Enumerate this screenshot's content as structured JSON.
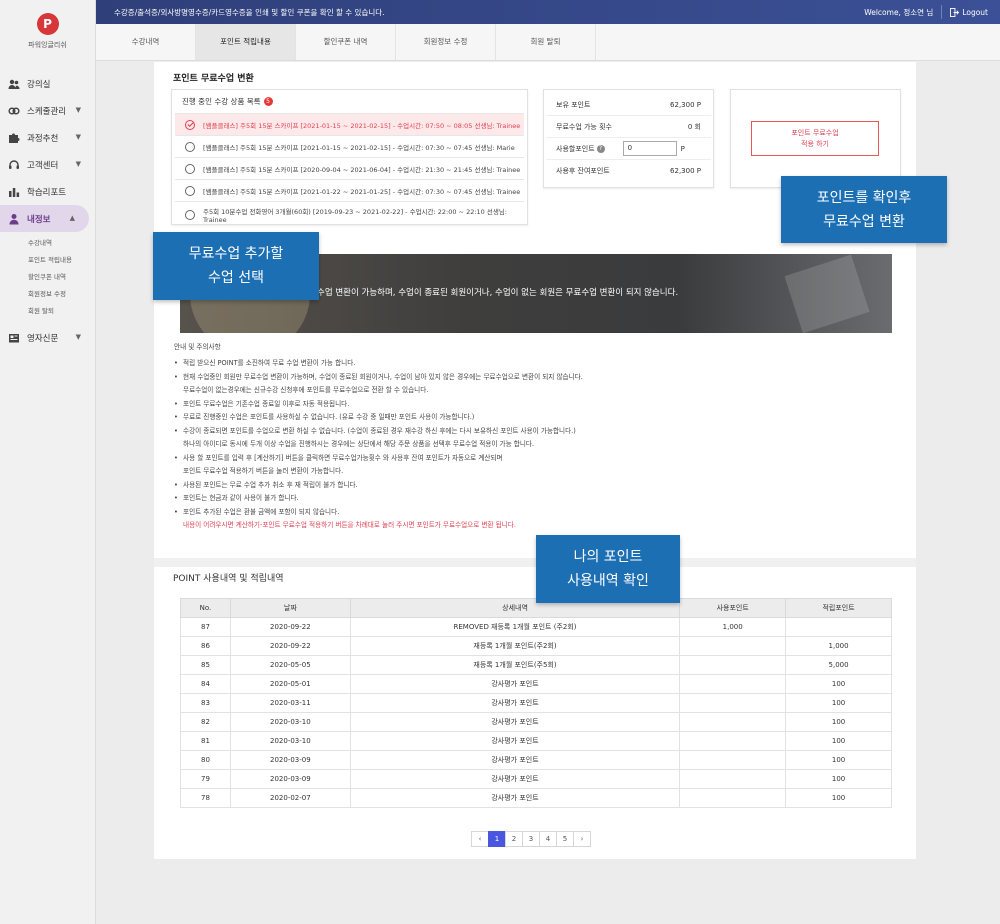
{
  "app": {
    "logo_letter": "P",
    "logo_text": "파워잉글리쉬"
  },
  "topbar": {
    "notice": "수강증/출석증/외사방명영수증/카드영수증을 인쇄 및 할인 쿠폰을 확인 할 수 있습니다.",
    "welcome": "Welcome, 정소연 님",
    "logout": "Logout"
  },
  "tabs": [
    "수강내역",
    "포인트 적립내용",
    "할인쿠폰 내역",
    "회원정보 수정",
    "회원 탈퇴"
  ],
  "sidebar": {
    "items": [
      "강의실",
      "스케줄관리",
      "과정추천",
      "고객센터",
      "학습리포트",
      "내정보",
      "영자신문"
    ],
    "submenu": [
      "수강내역",
      "포인트 적립내용",
      "할인쿠폰 내역",
      "회원정보 수정",
      "회원 탈퇴"
    ]
  },
  "convert": {
    "title": "포인트 무료수업 변환",
    "list_title": "진행 중인 수강 상품 목록",
    "badge": "5",
    "courses": [
      "[쌤플클래스] 주5회 15분 스카이프 [2021-01-15 ~ 2021-02-15] - 수업시간: 07:50 ~ 08:05 선생님: Trainee",
      "[쌤플클래스] 주5회 15분 스카이프 [2021-01-15 ~ 2021-02-15] - 수업시간: 07:30 ~ 07:45 선생님: Marie",
      "[쌤플클래스] 주5회 15분 스카이프 [2020-09-04 ~ 2021-06-04] - 수업시간: 21:30 ~ 21:45 선생님: Trainee",
      "[쌤플클래스] 주5회 15분 스카이프 [2021-01-22 ~ 2021-01-25] - 수업시간: 07:30 ~ 07:45 선생님: Trainee",
      "주5회 10분수업 전화영어 3개월(60회) [2019-09-23 ~ 2021-02-22] - 수업시간: 22:00 ~ 22:10 선생님: Trainee"
    ],
    "points": {
      "owned_label": "보유 포인트",
      "owned_value": "62,300 P",
      "count_label": "무료수업 가능 횟수",
      "count_value": "0 회",
      "use_label": "사용할포인트",
      "help": "?",
      "use_value": "0",
      "use_unit": "P",
      "remain_label": "사용후 잔여포인트",
      "remain_value": "62,300 P"
    },
    "apply_line1": "포인트 무료수업",
    "apply_line2": "적용 하기"
  },
  "banner": {
    "text": "수업 변환이 가능하며, 수업이 종료된 회원이거나, 수업이 없는 회원은 무료수업 변환이 되지 않습니다."
  },
  "notes": {
    "heading": "안내 및 주의사항",
    "lines": [
      {
        "t": "적립 받으신 POINT를 소진하여 무료 수업 변환이 가능 합니다.",
        "b": true
      },
      {
        "t": "현재 수업중인 회원만 무료수업 변환이 가능하며, 수업이 종료된 회원이거나, 수업이 남아 있지 않은 경우에는 무료수업으로 변환이 되지 않습니다.",
        "b": true
      },
      {
        "t": "무료수업이 없는경우에는 신규수강 신청후에 포인트를 무료수업으로 전환 할 수 있습니다.",
        "b": false
      },
      {
        "t": "포인트 무료수업은 기존수업 종료일 이후로 자동 적용됩니다.",
        "b": true
      },
      {
        "t": "무료로 진행중인 수업은 포인트를 사용하실 수 없습니다. (유료 수강 중 일때만 포인트 사용이 가능합니다.)",
        "b": true
      },
      {
        "t": "수강이 종료되면 포인트를 수업으로 변환 하실 수 없습니다. (수업이 종료된 경우 재수강 하신 후에는 다시 보유하신 포인트 사용이 가능합니다.)",
        "b": true
      },
      {
        "t": "하나의 아이디로 동시에 두개 이상 수업을 진행하시는 경우에는 상단에서 해당 주문 상품을 선택후 무료수업 적용이 가능 합니다.",
        "b": false
      },
      {
        "t": "사용 할 포인트를 입력 후 [계산하기] 버튼을 클릭하면 무료수업가능횟수 와 사용후 잔여 포인트가 자동으로 계산되며",
        "b": true
      },
      {
        "t": "포인트 무료수업 적용하기 버튼을 눌러 변환이 가능합니다.",
        "b": false
      },
      {
        "t": "사용된 포인트는 무료 수업 추가 취소 후 재 적립이 불가 합니다.",
        "b": true
      },
      {
        "t": "포인트는 현금과 같이 사용이 불가 합니다.",
        "b": true
      },
      {
        "t": "포인트 추가된 수업은 환불 금액에 포함이 되지 않습니다.",
        "b": true
      }
    ],
    "red": "내용이 어려우시면 계산하기-포인트 무료수업 적용하기 버튼을 차례대로 눌러 주시면 포인트가 무료수업으로 변환 됩니다."
  },
  "history": {
    "title": "POINT 사용내역 및 적립내역",
    "columns": [
      "No.",
      "날짜",
      "상세내역",
      "사용포인트",
      "적립포인트"
    ],
    "rows": [
      [
        "87",
        "2020-09-22",
        "REMOVED 재등록 1개월 포인트 (주2회)",
        "1,000",
        ""
      ],
      [
        "86",
        "2020-09-22",
        "재등록 1개월 포인트(주2회)",
        "",
        "1,000"
      ],
      [
        "85",
        "2020-05-05",
        "재등록 1개월 포인트(주5회)",
        "",
        "5,000"
      ],
      [
        "84",
        "2020-05-01",
        "강사평가 포인트",
        "",
        "100"
      ],
      [
        "83",
        "2020-03-11",
        "강사평가 포인트",
        "",
        "100"
      ],
      [
        "82",
        "2020-03-10",
        "강사평가 포인트",
        "",
        "100"
      ],
      [
        "81",
        "2020-03-10",
        "강사평가 포인트",
        "",
        "100"
      ],
      [
        "80",
        "2020-03-09",
        "강사평가 포인트",
        "",
        "100"
      ],
      [
        "79",
        "2020-03-09",
        "강사평가 포인트",
        "",
        "100"
      ],
      [
        "78",
        "2020-02-07",
        "강사평가 포인트",
        "",
        "100"
      ]
    ]
  },
  "pagination": {
    "prev": "‹",
    "pages": [
      "1",
      "2",
      "3",
      "4",
      "5"
    ],
    "next": "›"
  },
  "callouts": {
    "select_line1": "무료수업 추가할",
    "select_line2": "수업 선택",
    "confirm_line1": "포인트를 확인후",
    "confirm_line2": "무료수업 변환",
    "history_line1": "나의 포인트",
    "history_line2": "사용내역 확인"
  },
  "colors": {
    "accent": "#1d6fb4",
    "topbar": "#33447f",
    "selected": "#e04050",
    "page_active": "#4b56e0"
  }
}
